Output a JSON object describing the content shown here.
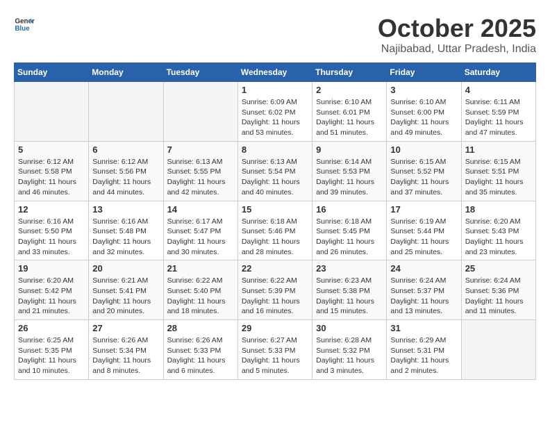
{
  "logo": {
    "general": "General",
    "blue": "Blue"
  },
  "title": "October 2025",
  "subtitle": "Najibabad, Uttar Pradesh, India",
  "weekdays": [
    "Sunday",
    "Monday",
    "Tuesday",
    "Wednesday",
    "Thursday",
    "Friday",
    "Saturday"
  ],
  "weeks": [
    [
      {
        "day": "",
        "sunrise": "",
        "sunset": "",
        "daylight": ""
      },
      {
        "day": "",
        "sunrise": "",
        "sunset": "",
        "daylight": ""
      },
      {
        "day": "",
        "sunrise": "",
        "sunset": "",
        "daylight": ""
      },
      {
        "day": "1",
        "sunrise": "Sunrise: 6:09 AM",
        "sunset": "Sunset: 6:02 PM",
        "daylight": "Daylight: 11 hours and 53 minutes."
      },
      {
        "day": "2",
        "sunrise": "Sunrise: 6:10 AM",
        "sunset": "Sunset: 6:01 PM",
        "daylight": "Daylight: 11 hours and 51 minutes."
      },
      {
        "day": "3",
        "sunrise": "Sunrise: 6:10 AM",
        "sunset": "Sunset: 6:00 PM",
        "daylight": "Daylight: 11 hours and 49 minutes."
      },
      {
        "day": "4",
        "sunrise": "Sunrise: 6:11 AM",
        "sunset": "Sunset: 5:59 PM",
        "daylight": "Daylight: 11 hours and 47 minutes."
      }
    ],
    [
      {
        "day": "5",
        "sunrise": "Sunrise: 6:12 AM",
        "sunset": "Sunset: 5:58 PM",
        "daylight": "Daylight: 11 hours and 46 minutes."
      },
      {
        "day": "6",
        "sunrise": "Sunrise: 6:12 AM",
        "sunset": "Sunset: 5:56 PM",
        "daylight": "Daylight: 11 hours and 44 minutes."
      },
      {
        "day": "7",
        "sunrise": "Sunrise: 6:13 AM",
        "sunset": "Sunset: 5:55 PM",
        "daylight": "Daylight: 11 hours and 42 minutes."
      },
      {
        "day": "8",
        "sunrise": "Sunrise: 6:13 AM",
        "sunset": "Sunset: 5:54 PM",
        "daylight": "Daylight: 11 hours and 40 minutes."
      },
      {
        "day": "9",
        "sunrise": "Sunrise: 6:14 AM",
        "sunset": "Sunset: 5:53 PM",
        "daylight": "Daylight: 11 hours and 39 minutes."
      },
      {
        "day": "10",
        "sunrise": "Sunrise: 6:15 AM",
        "sunset": "Sunset: 5:52 PM",
        "daylight": "Daylight: 11 hours and 37 minutes."
      },
      {
        "day": "11",
        "sunrise": "Sunrise: 6:15 AM",
        "sunset": "Sunset: 5:51 PM",
        "daylight": "Daylight: 11 hours and 35 minutes."
      }
    ],
    [
      {
        "day": "12",
        "sunrise": "Sunrise: 6:16 AM",
        "sunset": "Sunset: 5:50 PM",
        "daylight": "Daylight: 11 hours and 33 minutes."
      },
      {
        "day": "13",
        "sunrise": "Sunrise: 6:16 AM",
        "sunset": "Sunset: 5:48 PM",
        "daylight": "Daylight: 11 hours and 32 minutes."
      },
      {
        "day": "14",
        "sunrise": "Sunrise: 6:17 AM",
        "sunset": "Sunset: 5:47 PM",
        "daylight": "Daylight: 11 hours and 30 minutes."
      },
      {
        "day": "15",
        "sunrise": "Sunrise: 6:18 AM",
        "sunset": "Sunset: 5:46 PM",
        "daylight": "Daylight: 11 hours and 28 minutes."
      },
      {
        "day": "16",
        "sunrise": "Sunrise: 6:18 AM",
        "sunset": "Sunset: 5:45 PM",
        "daylight": "Daylight: 11 hours and 26 minutes."
      },
      {
        "day": "17",
        "sunrise": "Sunrise: 6:19 AM",
        "sunset": "Sunset: 5:44 PM",
        "daylight": "Daylight: 11 hours and 25 minutes."
      },
      {
        "day": "18",
        "sunrise": "Sunrise: 6:20 AM",
        "sunset": "Sunset: 5:43 PM",
        "daylight": "Daylight: 11 hours and 23 minutes."
      }
    ],
    [
      {
        "day": "19",
        "sunrise": "Sunrise: 6:20 AM",
        "sunset": "Sunset: 5:42 PM",
        "daylight": "Daylight: 11 hours and 21 minutes."
      },
      {
        "day": "20",
        "sunrise": "Sunrise: 6:21 AM",
        "sunset": "Sunset: 5:41 PM",
        "daylight": "Daylight: 11 hours and 20 minutes."
      },
      {
        "day": "21",
        "sunrise": "Sunrise: 6:22 AM",
        "sunset": "Sunset: 5:40 PM",
        "daylight": "Daylight: 11 hours and 18 minutes."
      },
      {
        "day": "22",
        "sunrise": "Sunrise: 6:22 AM",
        "sunset": "Sunset: 5:39 PM",
        "daylight": "Daylight: 11 hours and 16 minutes."
      },
      {
        "day": "23",
        "sunrise": "Sunrise: 6:23 AM",
        "sunset": "Sunset: 5:38 PM",
        "daylight": "Daylight: 11 hours and 15 minutes."
      },
      {
        "day": "24",
        "sunrise": "Sunrise: 6:24 AM",
        "sunset": "Sunset: 5:37 PM",
        "daylight": "Daylight: 11 hours and 13 minutes."
      },
      {
        "day": "25",
        "sunrise": "Sunrise: 6:24 AM",
        "sunset": "Sunset: 5:36 PM",
        "daylight": "Daylight: 11 hours and 11 minutes."
      }
    ],
    [
      {
        "day": "26",
        "sunrise": "Sunrise: 6:25 AM",
        "sunset": "Sunset: 5:35 PM",
        "daylight": "Daylight: 11 hours and 10 minutes."
      },
      {
        "day": "27",
        "sunrise": "Sunrise: 6:26 AM",
        "sunset": "Sunset: 5:34 PM",
        "daylight": "Daylight: 11 hours and 8 minutes."
      },
      {
        "day": "28",
        "sunrise": "Sunrise: 6:26 AM",
        "sunset": "Sunset: 5:33 PM",
        "daylight": "Daylight: 11 hours and 6 minutes."
      },
      {
        "day": "29",
        "sunrise": "Sunrise: 6:27 AM",
        "sunset": "Sunset: 5:33 PM",
        "daylight": "Daylight: 11 hours and 5 minutes."
      },
      {
        "day": "30",
        "sunrise": "Sunrise: 6:28 AM",
        "sunset": "Sunset: 5:32 PM",
        "daylight": "Daylight: 11 hours and 3 minutes."
      },
      {
        "day": "31",
        "sunrise": "Sunrise: 6:29 AM",
        "sunset": "Sunset: 5:31 PM",
        "daylight": "Daylight: 11 hours and 2 minutes."
      },
      {
        "day": "",
        "sunrise": "",
        "sunset": "",
        "daylight": ""
      }
    ]
  ]
}
